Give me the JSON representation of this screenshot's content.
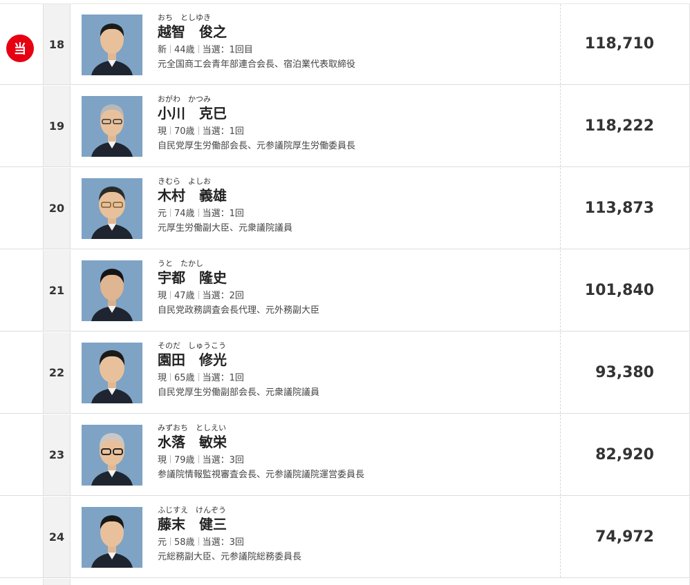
{
  "elected_badge_label": "当",
  "candidates": [
    {
      "number": "18",
      "kana": "おち　としゆき",
      "name": "越智　俊之",
      "status": "新",
      "age": "44歳",
      "elected_label": "当選：1回目",
      "career": "元全国商工会青年部連合会長、宿泊業代表取締役",
      "votes": "118,710",
      "elected": true
    },
    {
      "number": "19",
      "kana": "おがわ　かつみ",
      "name": "小川　克巳",
      "status": "現",
      "age": "70歳",
      "elected_label": "当選：1回",
      "career": "自民党厚生労働部会長、元参議院厚生労働委員長",
      "votes": "118,222",
      "elected": false
    },
    {
      "number": "20",
      "kana": "きむら　よしお",
      "name": "木村　義雄",
      "status": "元",
      "age": "74歳",
      "elected_label": "当選：1回",
      "career": "元厚生労働副大臣、元衆議院議員",
      "votes": "113,873",
      "elected": false
    },
    {
      "number": "21",
      "kana": "うと　たかし",
      "name": "宇都　隆史",
      "status": "現",
      "age": "47歳",
      "elected_label": "当選：2回",
      "career": "自民党政務調査会長代理、元外務副大臣",
      "votes": "101,840",
      "elected": false
    },
    {
      "number": "22",
      "kana": "そのだ　しゅうこう",
      "name": "園田　修光",
      "status": "現",
      "age": "65歳",
      "elected_label": "当選：1回",
      "career": "自民党厚生労働副部会長、元衆議院議員",
      "votes": "93,380",
      "elected": false
    },
    {
      "number": "23",
      "kana": "みずおち　としえい",
      "name": "水落　敏栄",
      "status": "現",
      "age": "79歳",
      "elected_label": "当選：3回",
      "career": "参議院情報監視審査会長、元参議院議院運営委員長",
      "votes": "82,920",
      "elected": false
    },
    {
      "number": "24",
      "kana": "ふじすえ　けんぞう",
      "name": "藤末　健三",
      "status": "元",
      "age": "58歳",
      "elected_label": "当選：3回",
      "career": "元総務副大臣、元参議院総務委員長",
      "votes": "74,972",
      "elected": false
    }
  ],
  "colors": {
    "badge": "#e60012",
    "photo_bg": "#7ea3c4",
    "number_cell_bg": "#f2f2f2"
  }
}
